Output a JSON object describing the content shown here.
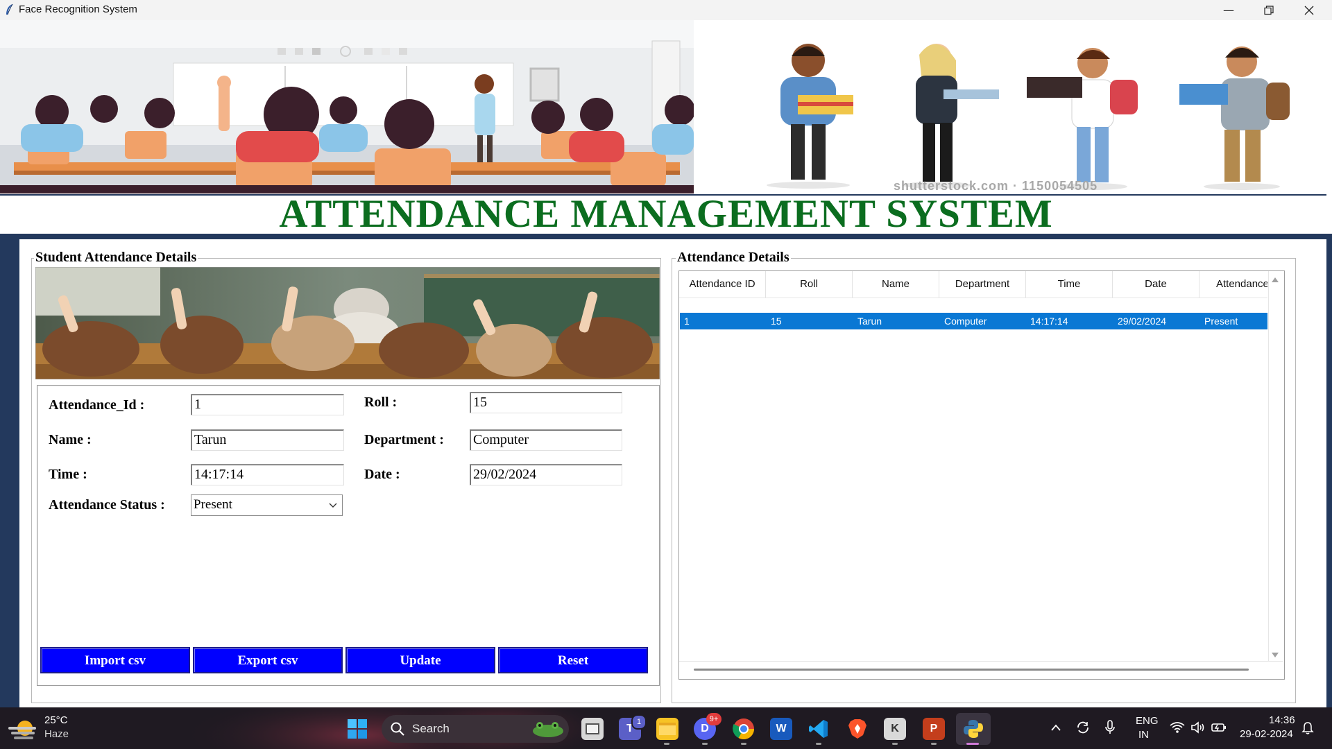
{
  "window": {
    "title": "Face Recognition System",
    "minimize_icon": "minimize-icon",
    "maximize_icon": "restore-icon",
    "close_icon": "close-icon"
  },
  "banner": {
    "watermark": "shutterstock.com · 1150054505"
  },
  "app": {
    "main_title": "ATTENDANCE MANAGEMENT SYSTEM",
    "title_color": "#0b6d1f",
    "frame_color": "#23395d"
  },
  "left_panel": {
    "legend": "Student Attendance Details",
    "fields": {
      "attendance_id": {
        "label": "Attendance_Id :",
        "value": "1"
      },
      "roll": {
        "label": "Roll :",
        "value": "15"
      },
      "name": {
        "label": "Name :",
        "value": "Tarun"
      },
      "department": {
        "label": "Department :",
        "value": "Computer"
      },
      "time": {
        "label": "Time :",
        "value": "14:17:14"
      },
      "date": {
        "label": "Date :",
        "value": "29/02/2024"
      },
      "status": {
        "label": "Attendance Status :",
        "value": "Present"
      }
    },
    "buttons": {
      "import": "Import csv",
      "export": "Export csv",
      "update": "Update",
      "reset": "Reset"
    },
    "button_color": "#0000ff"
  },
  "right_panel": {
    "legend": "Attendance Details",
    "columns": [
      "Attendance ID",
      "Roll",
      "Name",
      "Department",
      "Time",
      "Date",
      "Attendance"
    ],
    "rows": [
      [
        "1",
        "15",
        "Tarun",
        "Computer",
        "14:17:14",
        "29/02/2024",
        "Present"
      ]
    ],
    "selection_color": "#0a78d4"
  },
  "taskbar": {
    "weather": {
      "temp": "25°C",
      "condition": "Haze"
    },
    "search_placeholder": "Search",
    "teams_badge": "1",
    "discord_badge": "9+",
    "lang": {
      "line1": "ENG",
      "line2": "IN"
    },
    "clock": {
      "time": "14:36",
      "date": "29-02-2024"
    },
    "icons": [
      "start-icon",
      "search-icon",
      "task-view-icon",
      "teams-icon",
      "file-explorer-icon",
      "discord-icon",
      "chrome-icon",
      "word-icon",
      "vscode-icon",
      "brave-icon",
      "kodular-icon",
      "powerpoint-icon",
      "python-icon"
    ]
  }
}
